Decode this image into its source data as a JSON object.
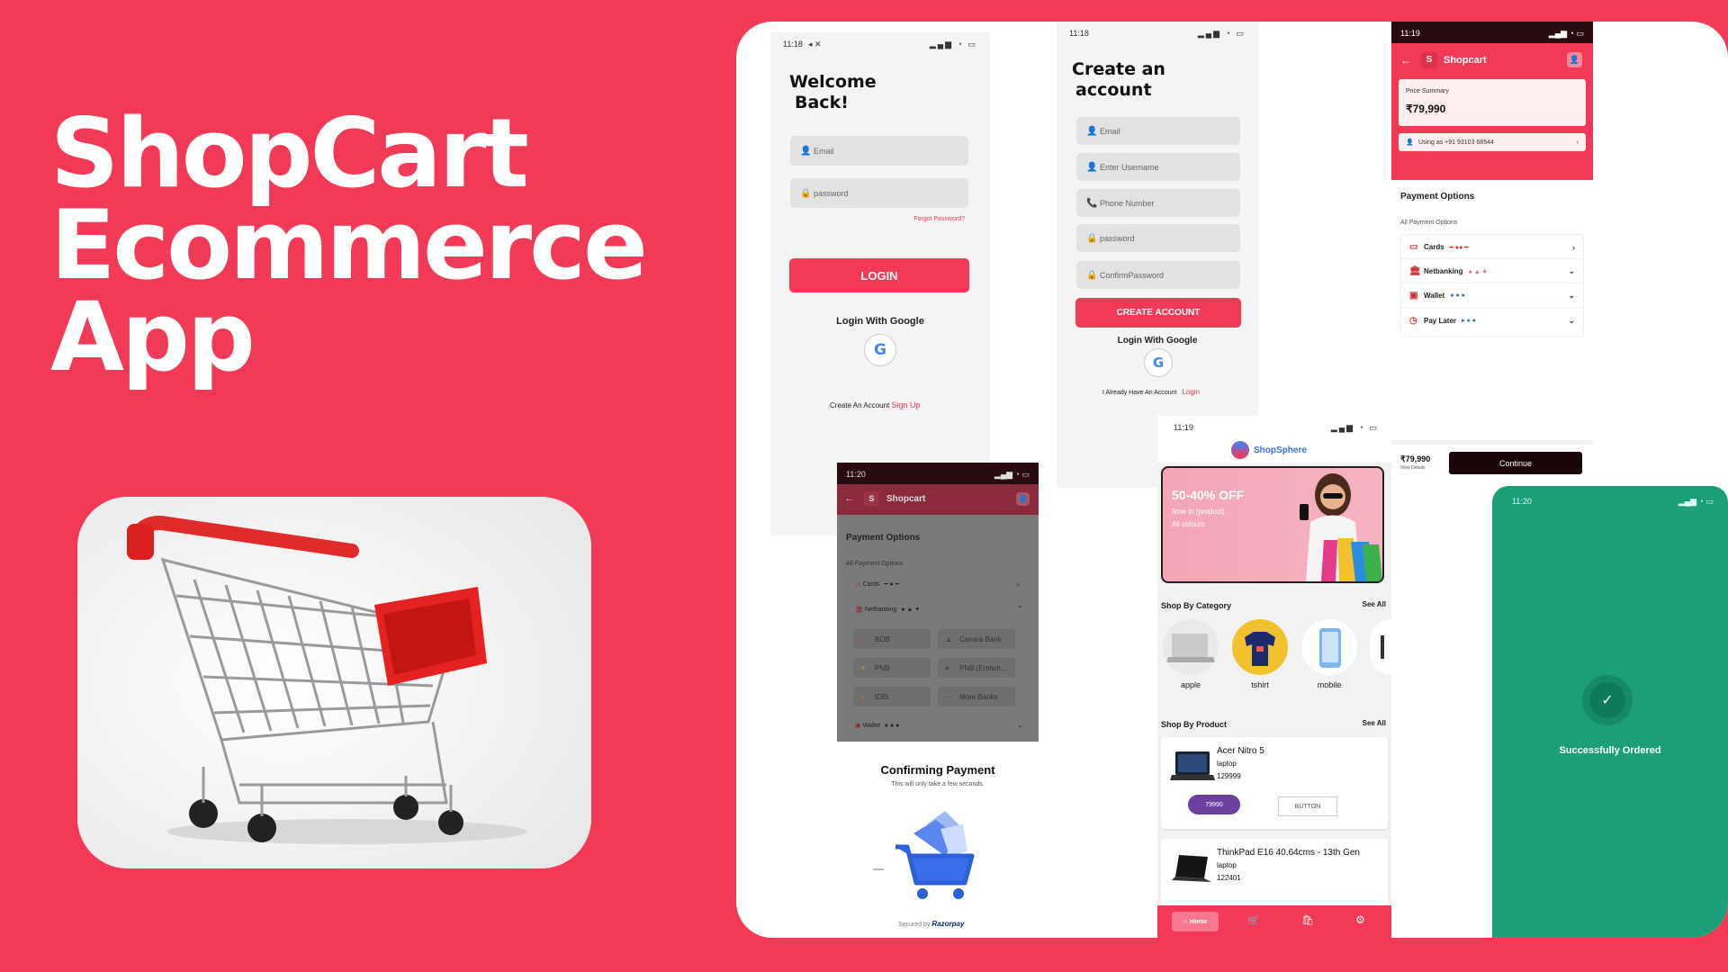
{
  "hero": {
    "line1": "ShopCart",
    "line2": "Ecommerce",
    "line3": "App"
  },
  "colors": {
    "brand": "#F23A58",
    "success": "#1C9E78",
    "dark": "#1a0508",
    "purple": "#6D3FA0"
  },
  "login": {
    "time": "11:18",
    "status_icons": "◂ ✕",
    "title1": "Welcome",
    "title2": "Back!",
    "email_placeholder": "Email",
    "password_placeholder": "password",
    "forgot": "Forgot Password?",
    "login_button": "LOGIN",
    "google_label": "Login With Google",
    "google_glyph": "G",
    "create_text": "Create An Account",
    "signup_link": "Sign Up"
  },
  "register": {
    "time": "11:18",
    "title1": "Create an",
    "title2": "account",
    "email": "Email",
    "username": "Enter Username",
    "phone": "Phone Number",
    "password": "password",
    "confirm": "ConfirmPassword",
    "create_button": "CREATE ACCOUNT",
    "google_label": "Login With Google",
    "google_glyph": "G",
    "already": "I Already Have An Account",
    "login_link": "Login"
  },
  "checkout": {
    "time": "11:19",
    "avatar_letter": "S",
    "brand": "Shopcart",
    "price_label": "Price Summary",
    "price": "₹79,990",
    "using_as": "Using as +91 93103 68544",
    "payment_options": "Payment Options",
    "all_options": "All Payment Options",
    "rows": [
      {
        "label": "Cards",
        "icon": "card-icon"
      },
      {
        "label": "Netbanking",
        "icon": "bank-icon"
      },
      {
        "label": "Wallet",
        "icon": "wallet-icon"
      },
      {
        "label": "Pay Later",
        "icon": "clock-icon"
      }
    ],
    "bottom_price": "₹79,990",
    "view_details": "View Details",
    "continue": "Continue"
  },
  "razorpay": {
    "time": "11:20",
    "avatar_letter": "S",
    "brand": "Shopcart",
    "payment_options": "Payment Options",
    "all_options": "All Payment Options",
    "cards": "Cards",
    "netbanking": "Netbanking",
    "banks": [
      "BOB",
      "Canara Bank",
      "PNB",
      "PNB (Erstwh...",
      "IDBI",
      "More Banks"
    ],
    "wallet": "Wallet",
    "confirming": "Confirming Payment",
    "confirm_sub": "This will only take a few seconds.",
    "secured_by": "Secured by",
    "razorpay_brand": "Razorpay"
  },
  "home": {
    "time": "11:19",
    "brand": "ShopSphere",
    "banner_title": "50-40% OFF",
    "banner_line1": "Now in (product)",
    "banner_line2": "All colours",
    "shop_by_category": "Shop By Category",
    "see_all": "See All",
    "categories": [
      "apple",
      "tshirt",
      "mobile"
    ],
    "shop_by_product": "Shop By Product",
    "see_all_2": "See All",
    "products": [
      {
        "name": "Acer Nitro 5",
        "category": "laptop",
        "price": "129999",
        "chip": "79990",
        "button": "BUTTON"
      },
      {
        "name": "ThinkPad E16 40.64cms - 13th Gen",
        "category": "laptop",
        "price": "122401"
      }
    ],
    "nav_home": "Home"
  },
  "success": {
    "time": "11:20",
    "message": "Successfully Ordered"
  }
}
